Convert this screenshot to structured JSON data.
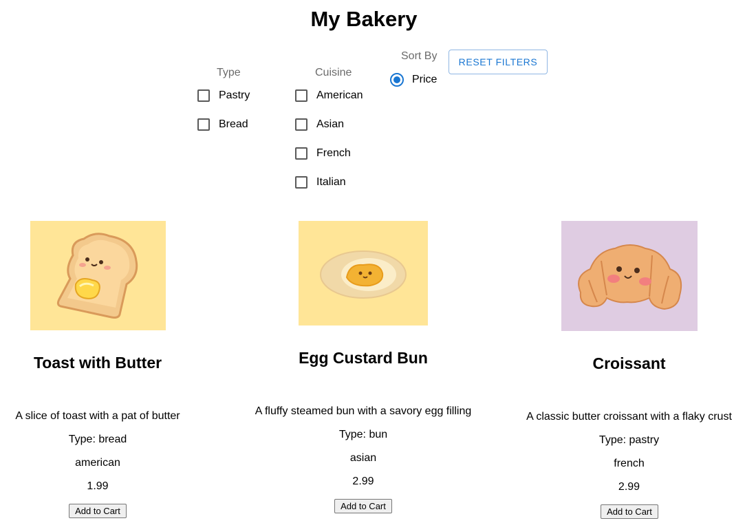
{
  "app": {
    "title": "My Bakery"
  },
  "filters": {
    "type": {
      "label": "Type",
      "options": [
        "Pastry",
        "Bread"
      ]
    },
    "cuisine": {
      "label": "Cuisine",
      "options": [
        "American",
        "Asian",
        "French",
        "Italian"
      ]
    },
    "sort": {
      "label": "Sort By",
      "selected": "Price"
    },
    "reset_label": "RESET FILTERS"
  },
  "items": [
    {
      "name": "Toast with Butter",
      "description": "A slice of toast with a pat of butter",
      "type": "Type: bread",
      "cuisine": "american",
      "price": "1.99",
      "button": "Add to Cart",
      "image_bg": "#ffe597"
    },
    {
      "name": "Egg Custard Bun",
      "description": "A fluffy steamed bun with a savory egg filling",
      "type": "Type: bun",
      "cuisine": "asian",
      "price": "2.99",
      "button": "Add to Cart",
      "image_bg": "#ffe597"
    },
    {
      "name": "Croissant",
      "description": "A classic butter croissant with a flaky crust",
      "type": "Type: pastry",
      "cuisine": "french",
      "price": "2.99",
      "button": "Add to Cart",
      "image_bg": "#dfcce2"
    }
  ],
  "colors": {
    "accent": "#1976d2"
  }
}
